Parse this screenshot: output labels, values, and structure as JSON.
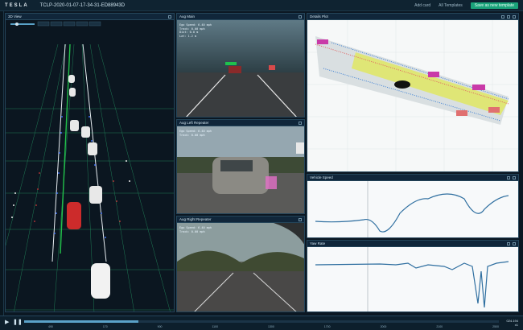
{
  "app": {
    "brand": "TESLA",
    "session_id": "TCLP-2020-01-07-17-34-31-ED88943D",
    "top_actions": [
      "Add card",
      "All Templates"
    ],
    "save_label": "Save as new template"
  },
  "panels": {
    "scene3d": {
      "title": "3D View",
      "toolbar": [
        "",
        "",
        "",
        "",
        ""
      ]
    },
    "cam_main": {
      "title": "Aug Main",
      "overlay": "Ego Speed: 6.40 mph\nTrack: 0.00 mph\nDist: 0.0 m\nLat: 1.2 m"
    },
    "cam_left": {
      "title": "Aug Left Repeater",
      "overlay": "Ego Speed: 6.40 mph\nTrack: 0.00 mph"
    },
    "cam_right": {
      "title": "Aug Right Repeater",
      "overlay": "Ego Speed: 6.40 mph\nTrack: 0.00 mph"
    },
    "details": {
      "title": "Details Plot"
    },
    "speed": {
      "title": "Vehicle Speed"
    },
    "yaw": {
      "title": "Yaw Rate"
    }
  },
  "timeline": {
    "ticks": [
      "490",
      "170",
      "900",
      "1100",
      "1300",
      "1700",
      "2000",
      "2100",
      "2500"
    ],
    "progress": 0.24,
    "readout_time": "024.194",
    "readout_speed": "x1"
  },
  "colors": {
    "accent": "#1aa37a",
    "line": "#4fa6c9",
    "bg": "#0b1722"
  }
}
